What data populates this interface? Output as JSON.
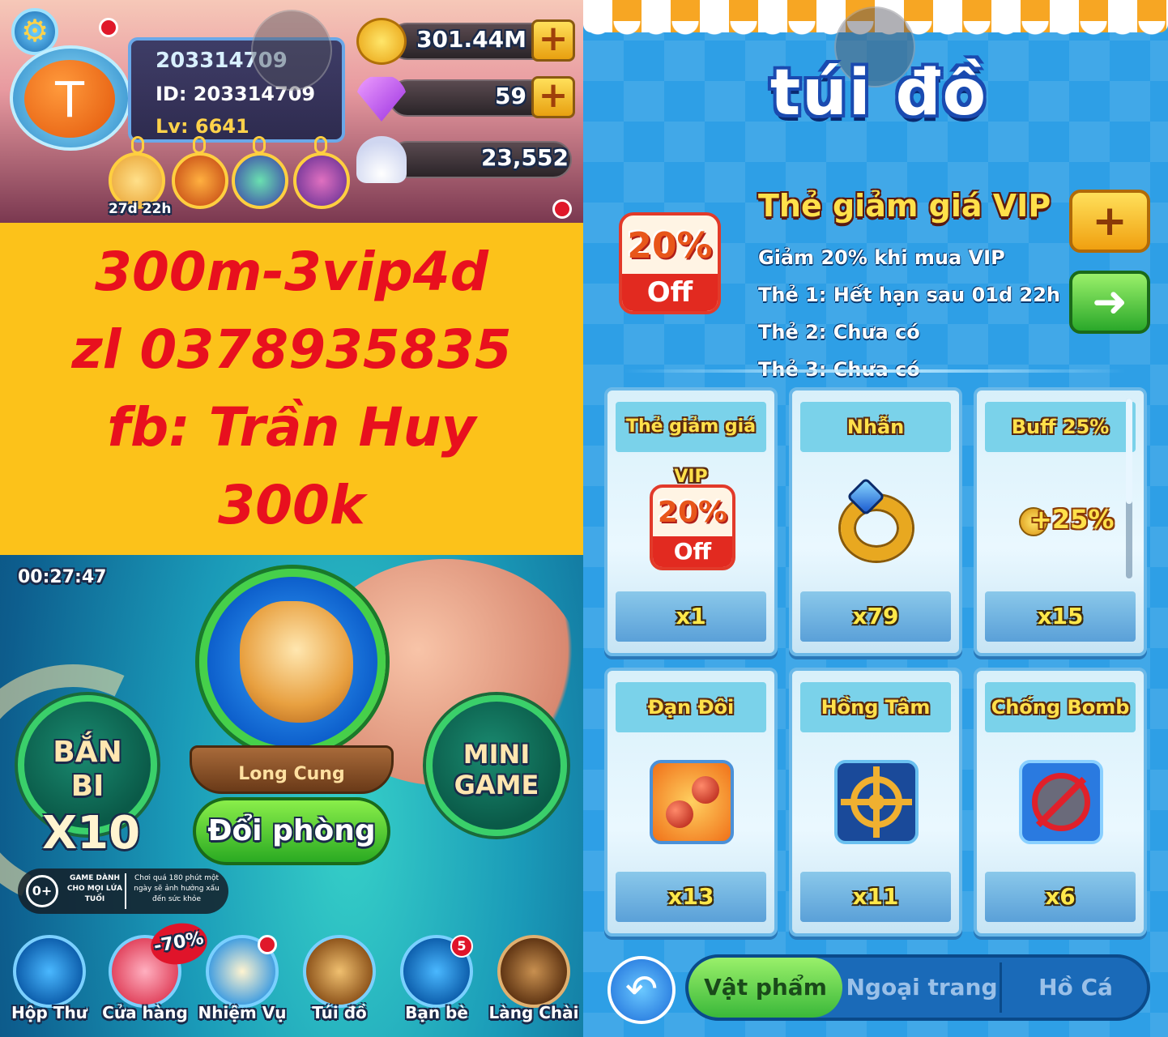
{
  "left": {
    "profile": {
      "name": "203314709",
      "id_line": "ID: 203314709",
      "level_line": "Lv: 6641",
      "avatar_letter": "T",
      "vip_timer": "27d 22h"
    },
    "currencies": {
      "gold": "301.44M",
      "gems": "59",
      "shells": "23,552"
    },
    "promo": {
      "lines": [
        "300m-3vip4d",
        "zl 0378935835",
        "fb: Trần Huy",
        "300k"
      ],
      "background": "#fcc21a",
      "text_color": "#e8101e"
    },
    "event_timer": "00:27:47",
    "buttons": {
      "marble": {
        "line1": "BẮN",
        "line2": "BI",
        "multiplier": "X10"
      },
      "minigame": {
        "line1": "MINI",
        "line2": "GAME"
      },
      "room_name": "Long Cung",
      "change_room": "Đổi phòng"
    },
    "age_notice": {
      "rating": "0+",
      "title": "GAME DÀNH CHO MỌI LỨA TUỔI",
      "warning": "Chơi quá 180 phút một ngày sẽ ảnh hưởng xấu đến sức khỏe"
    },
    "shop_discount": "-70%",
    "friends_badge": "5",
    "nav": [
      {
        "label": "Hộp Thư",
        "icon": "mailbox-icon"
      },
      {
        "label": "Cửa hàng",
        "icon": "shop-icon"
      },
      {
        "label": "Nhiệm Vụ",
        "icon": "quest-clipboard-icon"
      },
      {
        "label": "Túi đồ",
        "icon": "bag-icon"
      },
      {
        "label": "Bạn bè",
        "icon": "friends-icon"
      },
      {
        "label": "Làng Chài",
        "icon": "fishing-village-icon"
      }
    ]
  },
  "right": {
    "title": "túi đồ",
    "vip": {
      "title": "Thẻ giảm giá VIP",
      "lines": [
        "Giảm 20% khi mua VIP",
        "Thẻ 1: Hết hạn sau 01d 22h",
        "Thẻ 2: Chưa có",
        "Thẻ 3: Chưa có"
      ],
      "coupon_pct": "20%",
      "coupon_off": "Off"
    },
    "items": [
      {
        "name": "Thẻ giảm giá VIP",
        "count": "x1",
        "icon": "vip-coupon-icon"
      },
      {
        "name": "Nhẫn",
        "count": "x79",
        "icon": "ring-icon"
      },
      {
        "name": "Buff 25%",
        "count": "x15",
        "icon": "gold-buff-icon",
        "icon_text": "+25%"
      },
      {
        "name": "Đạn Đôi",
        "count": "x13",
        "icon": "double-bullet-icon"
      },
      {
        "name": "Hồng Tâm",
        "count": "x11",
        "icon": "crosshair-icon"
      },
      {
        "name": "Chống Bomb",
        "count": "x6",
        "icon": "anti-bomb-icon"
      }
    ],
    "tabs": [
      {
        "label": "Vật phẩm",
        "active": true
      },
      {
        "label": "Ngoại trang",
        "active": false
      },
      {
        "label": "Hồ Cá",
        "active": false
      }
    ]
  }
}
